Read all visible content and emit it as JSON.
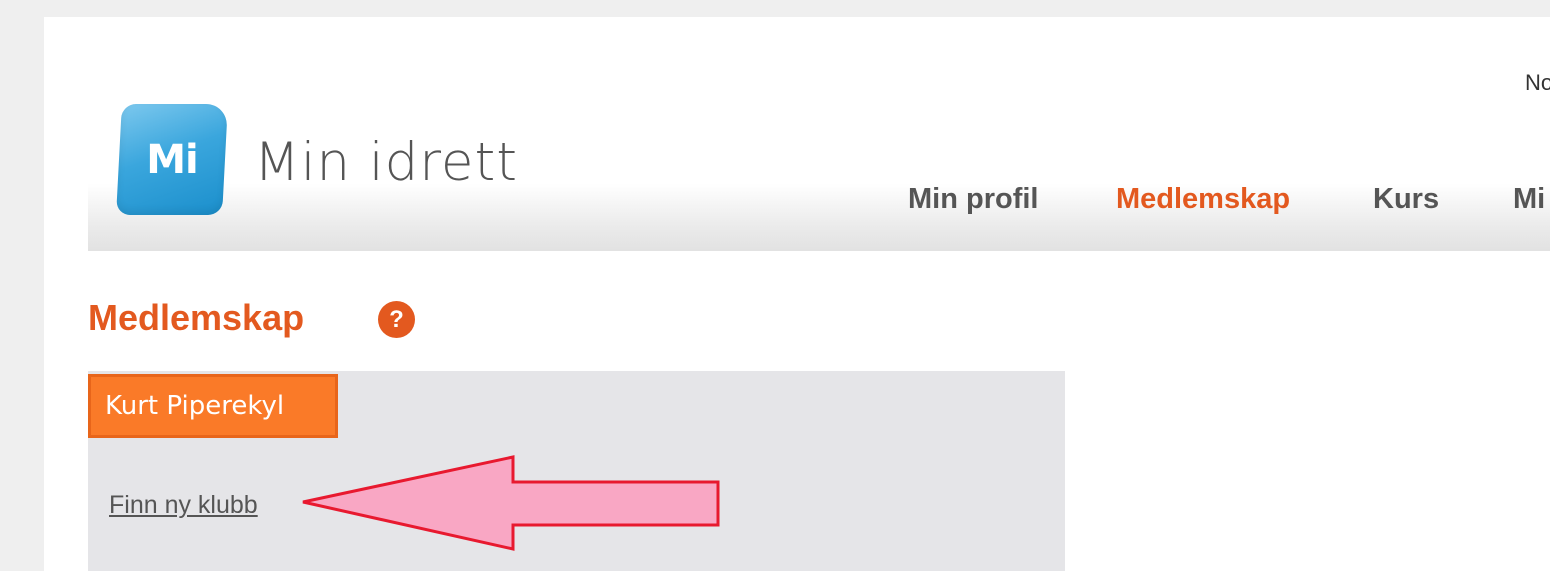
{
  "header": {
    "logo_badge": "Mi",
    "logo_text": "Min idrett",
    "lang_link": "No"
  },
  "nav": {
    "items": [
      {
        "label": "Min profil",
        "active": false
      },
      {
        "label": "Medlemskap",
        "active": true
      },
      {
        "label": "Kurs",
        "active": false
      },
      {
        "label": "Mi",
        "active": false
      }
    ]
  },
  "main": {
    "title": "Medlemskap",
    "help_icon": "?",
    "member_tab_label": "Kurt Piperekyl",
    "find_club_link": "Finn ny klubb"
  },
  "annotation": {
    "arrow_fill": "#f9a7c4",
    "arrow_stroke": "#e8192f"
  },
  "colors": {
    "accent": "#e3591f",
    "tab_orange": "#fa7a28",
    "panel_bg": "#e5e5e8",
    "logo_blue": "#3aa6dd"
  }
}
